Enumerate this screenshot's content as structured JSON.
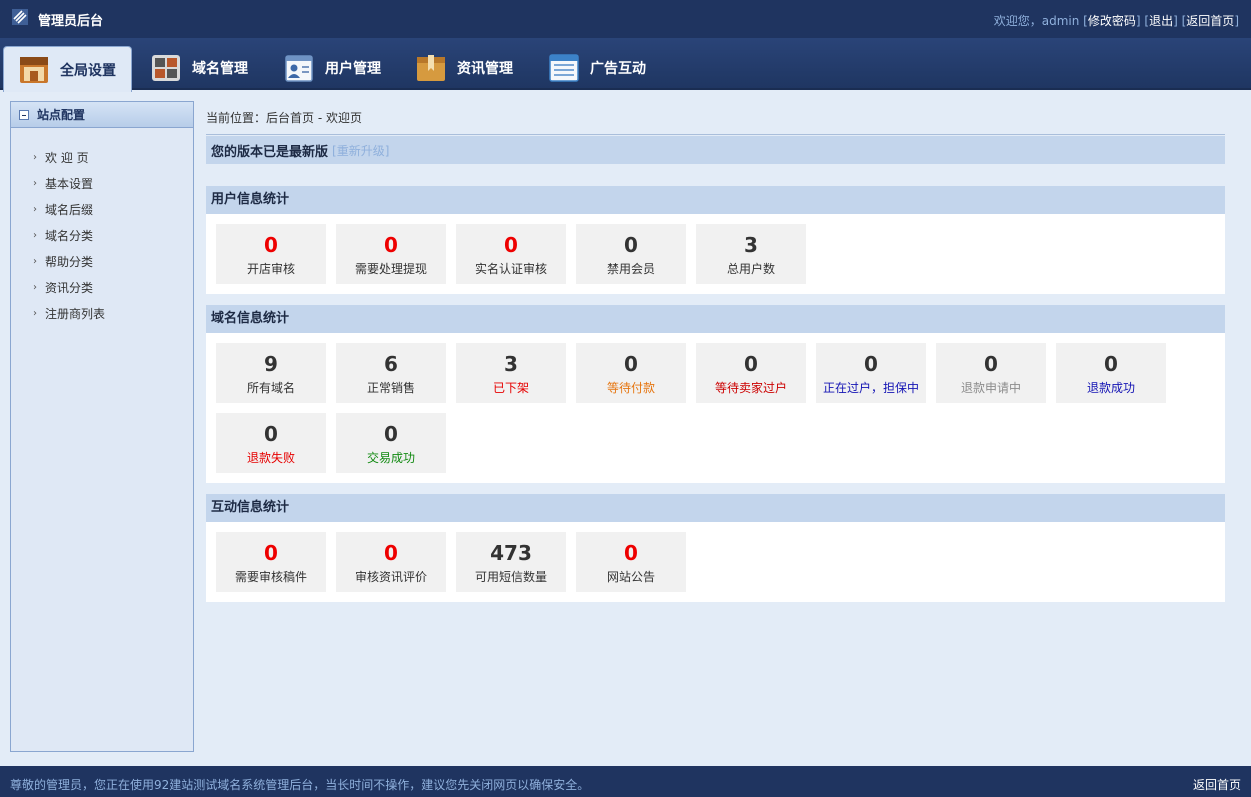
{
  "app": {
    "title": "管理员后台"
  },
  "top_links": {
    "welcome": "欢迎您，admin",
    "change_password": "修改密码",
    "logout": "退出",
    "home": "返回首页"
  },
  "nav": {
    "tabs": [
      {
        "label": "全局设置",
        "icon": "store-icon"
      },
      {
        "label": "域名管理",
        "icon": "grid-icon"
      },
      {
        "label": "用户管理",
        "icon": "user-card-icon"
      },
      {
        "label": "资讯管理",
        "icon": "folder-icon"
      },
      {
        "label": "广告互动",
        "icon": "list-window-icon"
      }
    ]
  },
  "sidebar": {
    "title": "站点配置",
    "items": [
      {
        "label": "欢 迎 页"
      },
      {
        "label": "基本设置"
      },
      {
        "label": "域名后缀"
      },
      {
        "label": "域名分类"
      },
      {
        "label": "帮助分类"
      },
      {
        "label": "资讯分类"
      },
      {
        "label": "注册商列表"
      }
    ]
  },
  "breadcrumb": "当前位置：后台首页 - 欢迎页",
  "version": {
    "text": "您的版本已是最新版",
    "upgrade": "[重新升级]"
  },
  "sections": {
    "user": {
      "title": "用户信息统计",
      "cards": [
        {
          "value": "0",
          "label": "开店审核",
          "num_color": "#ee0000",
          "lbl_color": "#333333"
        },
        {
          "value": "0",
          "label": "需要处理提现",
          "num_color": "#ee0000",
          "lbl_color": "#333333"
        },
        {
          "value": "0",
          "label": "实名认证审核",
          "num_color": "#ee0000",
          "lbl_color": "#333333"
        },
        {
          "value": "0",
          "label": "禁用会员",
          "num_color": "#333333",
          "lbl_color": "#333333"
        },
        {
          "value": "3",
          "label": "总用户数",
          "num_color": "#333333",
          "lbl_color": "#333333"
        }
      ]
    },
    "domain": {
      "title": "域名信息统计",
      "cards": [
        {
          "value": "9",
          "label": "所有域名",
          "num_color": "#333333",
          "lbl_color": "#333333"
        },
        {
          "value": "6",
          "label": "正常销售",
          "num_color": "#333333",
          "lbl_color": "#333333"
        },
        {
          "value": "3",
          "label": "已下架",
          "num_color": "#333333",
          "lbl_color": "#e60000"
        },
        {
          "value": "0",
          "label": "等待付款",
          "num_color": "#333333",
          "lbl_color": "#e6750f"
        },
        {
          "value": "0",
          "label": "等待卖家过户",
          "num_color": "#333333",
          "lbl_color": "#cc0000"
        },
        {
          "value": "0",
          "label": "正在过户，担保中",
          "num_color": "#333333",
          "lbl_color": "#1414b4"
        },
        {
          "value": "0",
          "label": "退款申请中",
          "num_color": "#333333",
          "lbl_color": "#8c8c8c"
        },
        {
          "value": "0",
          "label": "退款成功",
          "num_color": "#333333",
          "lbl_color": "#1414b4"
        },
        {
          "value": "0",
          "label": "退款失败",
          "num_color": "#333333",
          "lbl_color": "#e60000"
        },
        {
          "value": "0",
          "label": "交易成功",
          "num_color": "#333333",
          "lbl_color": "#128a12"
        }
      ]
    },
    "interact": {
      "title": "互动信息统计",
      "cards": [
        {
          "value": "0",
          "label": "需要审核稿件",
          "num_color": "#ee0000",
          "lbl_color": "#333333"
        },
        {
          "value": "0",
          "label": "审核资讯评价",
          "num_color": "#ee0000",
          "lbl_color": "#333333"
        },
        {
          "value": "473",
          "label": "可用短信数量",
          "num_color": "#333333",
          "lbl_color": "#333333"
        },
        {
          "value": "0",
          "label": "网站公告",
          "num_color": "#ee0000",
          "lbl_color": "#333333"
        }
      ]
    }
  },
  "footer": {
    "message": "尊敬的管理员，您正在使用92建站测试域名系统管理后台，当长时间不操作，建议您先关闭网页以确保安全。",
    "home": "返回首页"
  }
}
